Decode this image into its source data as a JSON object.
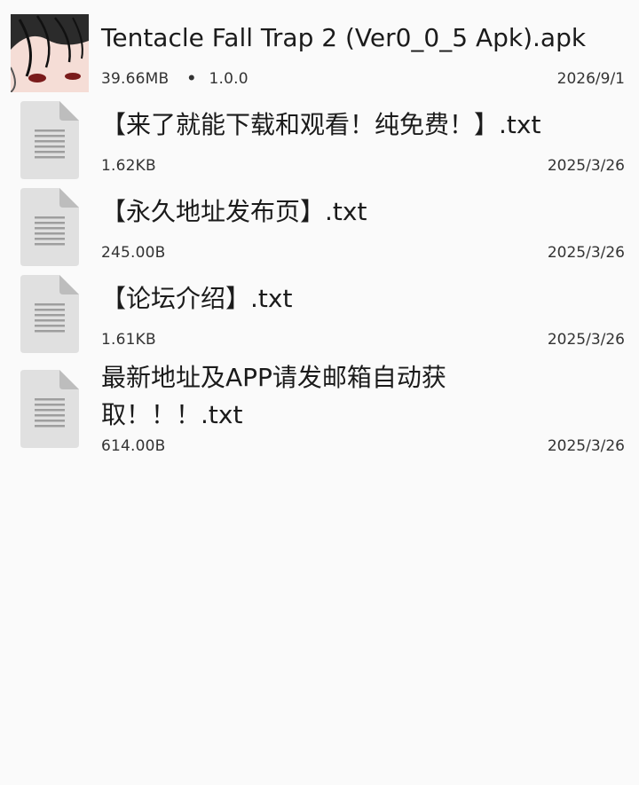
{
  "files": [
    {
      "kind": "apk",
      "icon": "apk-thumbnail",
      "name": "Tentacle Fall Trap 2 (Ver0_0_5 Apk).apk",
      "size": "39.66MB",
      "separator": "•",
      "version": "1.0.0",
      "date": "2026/9/1"
    },
    {
      "kind": "txt",
      "icon": "document-icon",
      "name": "【来了就能下载和观看！纯免费！】.txt",
      "size": "1.62KB",
      "date": "2025/3/26"
    },
    {
      "kind": "txt",
      "icon": "document-icon",
      "name": "【永久地址发布页】.txt",
      "size": "245.00B",
      "date": "2025/3/26"
    },
    {
      "kind": "txt",
      "icon": "document-icon",
      "name": "【论坛介绍】.txt",
      "size": "1.61KB",
      "date": "2025/3/26"
    },
    {
      "kind": "txt",
      "icon": "document-icon",
      "name": "最新地址及APP请发邮箱自动获取！！！.txt",
      "size": "614.00B",
      "date": "2025/3/26"
    }
  ],
  "colors": {
    "background": "#fafafa",
    "text_primary": "#1b1b1b",
    "text_secondary": "#333333",
    "doc_icon_fill": "#e0e0e0",
    "doc_icon_lines": "#9e9e9e"
  }
}
